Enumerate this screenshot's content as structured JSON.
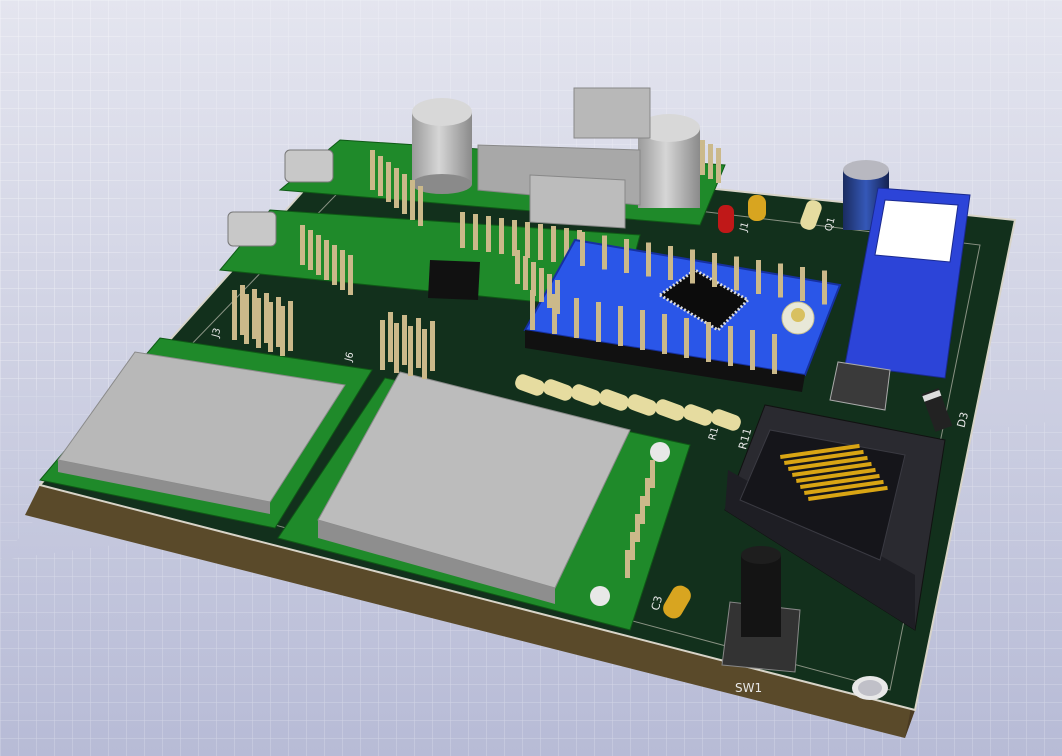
{
  "viewer": {
    "background_top": "#e4e5ef",
    "background_bottom": "#b7bbd6",
    "grid_color": "#ffffff"
  },
  "board": {
    "solder_mask": "#12301c",
    "edge_color": "#d8d4c8",
    "pad_color": "#c9b458"
  },
  "labels": {
    "switch": "SW1",
    "capacitor": "C3",
    "diode": "D3",
    "resistor_a": "R11",
    "resistor_b": "R1",
    "connector_a": "J3",
    "connector_b": "J6",
    "connector_c": "J1",
    "regulator": "Q1"
  },
  "components": {
    "arduino_color": "#2a56e8",
    "module_color": "#1f8a2a",
    "shield_color": "#b8b8b8",
    "header_color": "#cbb98a",
    "rj45_color": "#2a2a30",
    "contact_color": "#d9a514",
    "relay_color": "#2c44d8"
  }
}
